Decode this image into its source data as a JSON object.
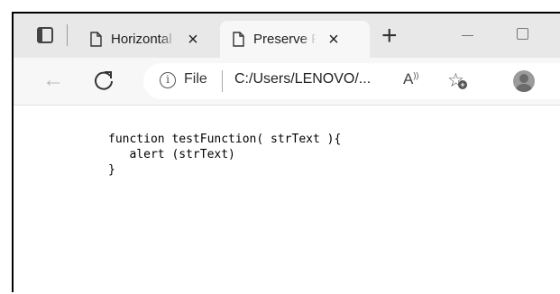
{
  "tabs": [
    {
      "title": "Horizontal",
      "close": "×"
    },
    {
      "title": "Preserve F",
      "close": "×"
    }
  ],
  "new_tab_label": "+",
  "address_bar": {
    "scheme_label": "File",
    "url": "C:/Users/LENOVO/...",
    "read_aloud_label": "A"
  },
  "page": {
    "code_lines": [
      "function testFunction( strText ){",
      "   alert (strText)",
      "}"
    ]
  },
  "icons": {
    "tab_actions": "tab-actions-icon",
    "page": "page-icon",
    "back": "back-arrow-icon",
    "refresh": "refresh-icon",
    "info": "info-icon",
    "favorites": "add-favorite-icon",
    "profile": "profile-icon",
    "minimize": "minimize-icon",
    "maximize": "maximize-icon"
  }
}
